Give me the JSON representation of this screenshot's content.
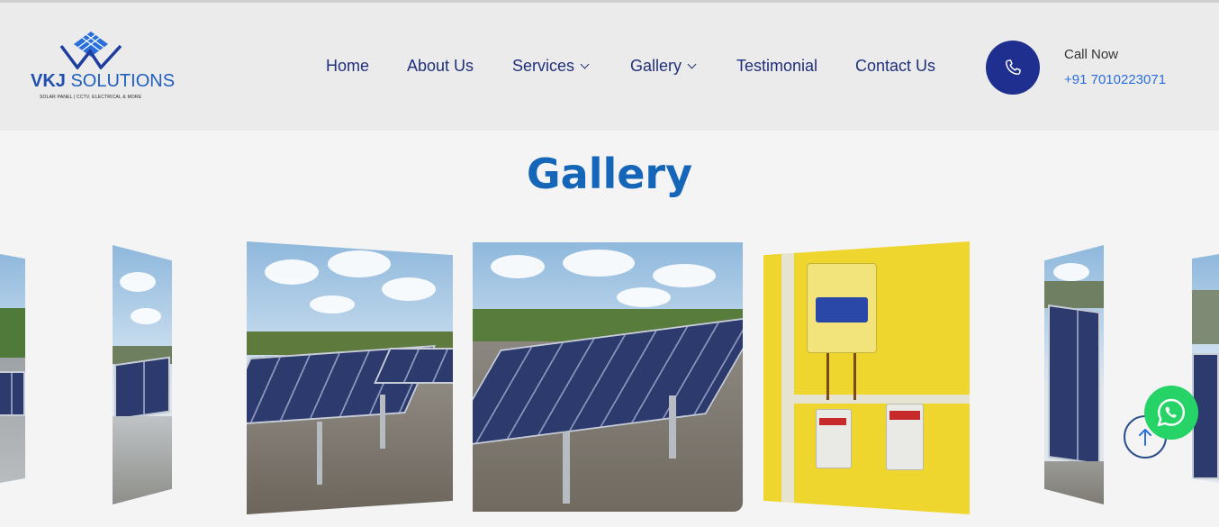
{
  "brand": {
    "name_bold": "VKJ",
    "name_light": "SOLUTIONS",
    "tagline": "SOLAR PANEL | CCTV, ELECTRICAL & MORE",
    "primary_color": "#1f2f8f",
    "accent_color": "#1565b8"
  },
  "nav": {
    "items": [
      {
        "label": "Home",
        "has_dropdown": false
      },
      {
        "label": "About Us",
        "has_dropdown": false
      },
      {
        "label": "Services",
        "has_dropdown": true
      },
      {
        "label": "Gallery",
        "has_dropdown": true
      },
      {
        "label": "Testimonial",
        "has_dropdown": false
      },
      {
        "label": "Contact Us",
        "has_dropdown": false
      }
    ]
  },
  "contact": {
    "call_label": "Call Now",
    "phone": "+91 7010223071",
    "icon": "phone-icon"
  },
  "gallery": {
    "title": "Gallery",
    "slides": [
      {
        "subject": "solar-panels-rooftop"
      },
      {
        "subject": "solar-panels-rooftop"
      },
      {
        "subject": "solar-panels-rooftop"
      },
      {
        "subject": "solar-panels-rooftop"
      },
      {
        "subject": "inverter-yellow-wall"
      },
      {
        "subject": "solar-panels-rooftop"
      },
      {
        "subject": "solar-panels-rooftop"
      }
    ]
  },
  "floating": {
    "scroll_top_icon": "arrow-up-icon",
    "whatsapp_icon": "whatsapp-icon",
    "whatsapp_color": "#25d366"
  }
}
